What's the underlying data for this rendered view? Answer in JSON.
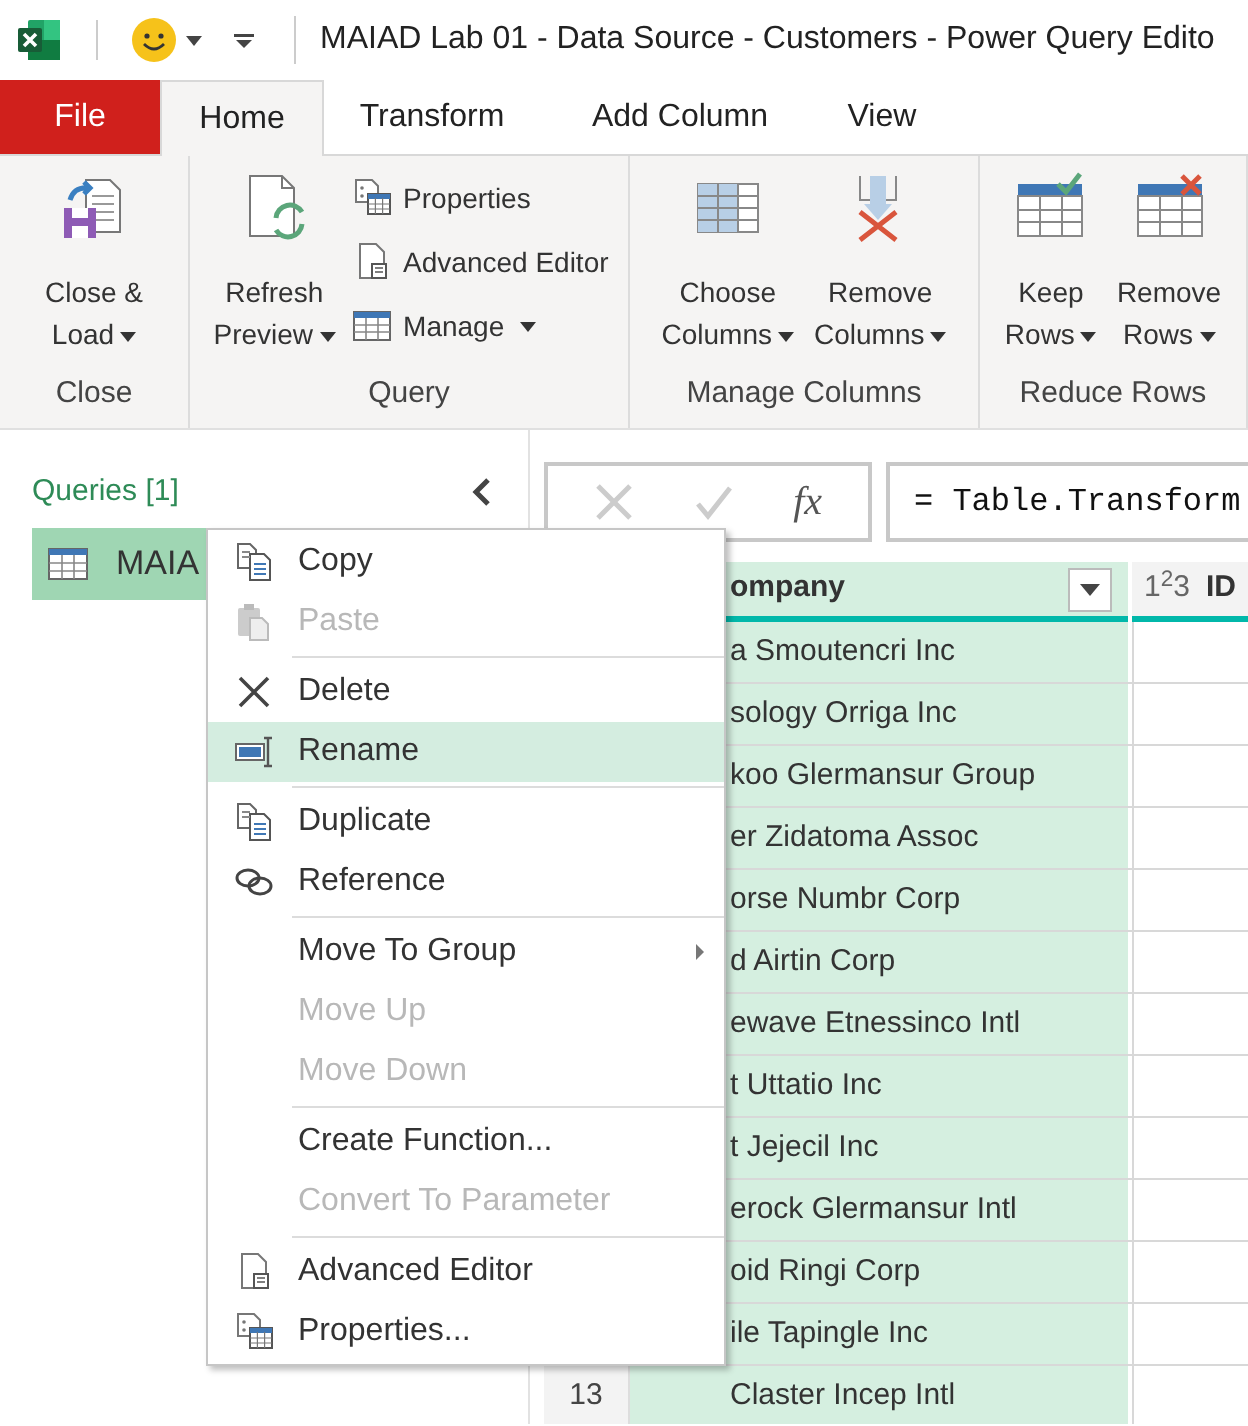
{
  "window": {
    "title": "MAIAD Lab 01 - Data Source - Customers - Power Query Edito"
  },
  "tabs": [
    {
      "label": "File",
      "kind": "file",
      "selected": false
    },
    {
      "label": "Home",
      "kind": "tab",
      "selected": true
    },
    {
      "label": "Transform",
      "kind": "tab",
      "selected": false
    },
    {
      "label": "Add Column",
      "kind": "tab",
      "selected": false
    },
    {
      "label": "View",
      "kind": "tab",
      "selected": false
    }
  ],
  "ribbon_groups": [
    {
      "label": "Close",
      "buttons": [
        {
          "kind": "large",
          "label": "Close &\nLoad",
          "dropdown": true
        }
      ]
    },
    {
      "label": "Query",
      "buttons": [
        {
          "kind": "large",
          "label": "Refresh\nPreview",
          "dropdown": true
        },
        {
          "kind": "small",
          "label": "Properties",
          "dropdown": false
        },
        {
          "kind": "small",
          "label": "Advanced Editor",
          "dropdown": false
        },
        {
          "kind": "small",
          "label": "Manage",
          "dropdown": true
        }
      ]
    },
    {
      "label": "Manage Columns",
      "buttons": [
        {
          "kind": "large",
          "label": "Choose\nColumns",
          "dropdown": true
        },
        {
          "kind": "large",
          "label": "Remove\nColumns",
          "dropdown": true
        }
      ]
    },
    {
      "label": "Reduce Rows",
      "buttons": [
        {
          "kind": "large",
          "label": "Keep\nRows",
          "dropdown": true
        },
        {
          "kind": "large",
          "label": "Remove\nRows",
          "dropdown": true
        }
      ]
    }
  ],
  "queries_pane": {
    "title": "Queries [1]",
    "items": [
      {
        "label": "MAIA",
        "selected": true
      }
    ]
  },
  "formula_bar": {
    "fx": "fx",
    "formula": "= Table.Transform"
  },
  "table": {
    "columns": [
      {
        "label": "ompany"
      },
      {
        "label": "ID",
        "type": "1$^{2}$3"
      }
    ],
    "rows": [
      {
        "company": "a Smoutencri Inc"
      },
      {
        "company": "sology Orriga Inc"
      },
      {
        "company": "koo Glermansur Group"
      },
      {
        "company": "er Zidatoma Assoc"
      },
      {
        "company": "orse Numbr Corp"
      },
      {
        "company": "d Airtin Corp"
      },
      {
        "company": "ewave Etnessinco Intl"
      },
      {
        "company": "t Uttatio Inc"
      },
      {
        "company": "t Jejecil Inc"
      },
      {
        "company": "erock Glermansur Intl"
      },
      {
        "company": "oid Ringi Corp"
      },
      {
        "company": "ile Tapingle Inc"
      },
      {
        "number": "13",
        "company": "Claster Incep Intl"
      }
    ]
  },
  "context_menu": [
    {
      "kind": "item",
      "label": "Copy",
      "disabled": false,
      "selected": false
    },
    {
      "kind": "item",
      "label": "Paste",
      "disabled": true,
      "selected": false
    },
    {
      "kind": "separator"
    },
    {
      "kind": "item",
      "label": "Delete",
      "disabled": false,
      "selected": false
    },
    {
      "kind": "item",
      "label": "Rename",
      "disabled": false,
      "selected": true
    },
    {
      "kind": "separator"
    },
    {
      "kind": "item",
      "label": "Duplicate",
      "disabled": false,
      "selected": false
    },
    {
      "kind": "item",
      "label": "Reference",
      "disabled": false,
      "selected": false
    },
    {
      "kind": "separator"
    },
    {
      "kind": "submenu",
      "label": "Move To Group",
      "disabled": false,
      "selected": false
    },
    {
      "kind": "item",
      "label": "Move Up",
      "disabled": true,
      "selected": false
    },
    {
      "kind": "item",
      "label": "Move Down",
      "disabled": true,
      "selected": false
    },
    {
      "kind": "separator"
    },
    {
      "kind": "item",
      "label": "Create Function...",
      "disabled": false,
      "selected": false
    },
    {
      "kind": "item",
      "label": "Convert To Parameter",
      "disabled": true,
      "selected": false
    },
    {
      "kind": "separator"
    },
    {
      "kind": "item",
      "label": "Advanced Editor",
      "disabled": false,
      "selected": false
    },
    {
      "kind": "item",
      "label": "Properties...",
      "disabled": false,
      "selected": false
    }
  ]
}
